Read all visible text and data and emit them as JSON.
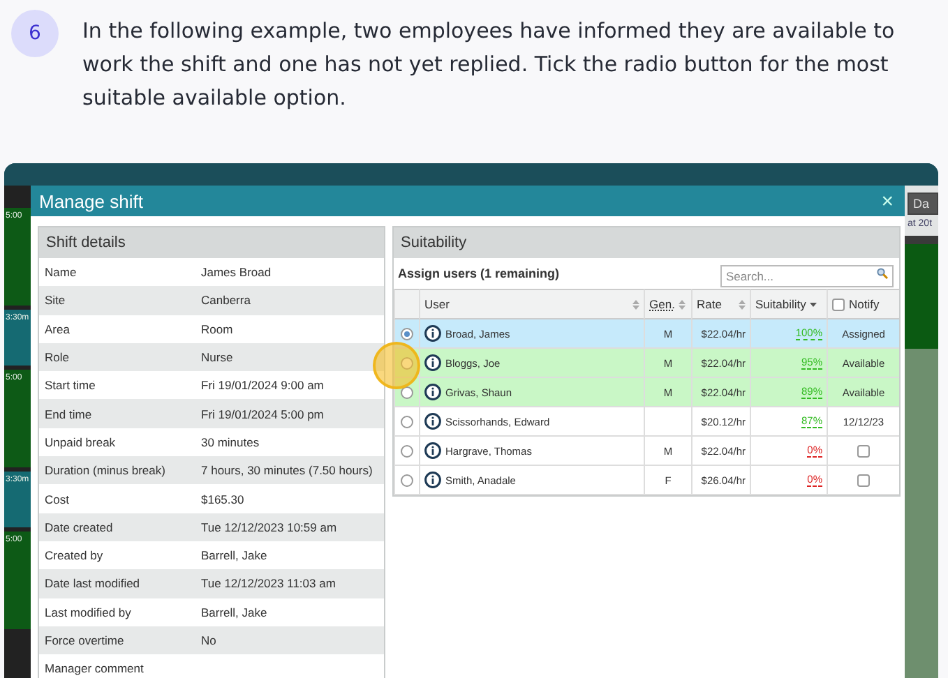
{
  "step": {
    "number": "6",
    "text": "In the following example, two employees have informed they are available to work the shift and one has not yet replied. Tick the radio button for the most suitable available option."
  },
  "background": {
    "left_fragments": [
      "5:00",
      "3:30m",
      "5:00",
      "3:30m",
      "5:00"
    ],
    "right_button": "Da",
    "right_text": "at 20t"
  },
  "dialog": {
    "title": "Manage shift",
    "close": "×",
    "shift_details": {
      "title": "Shift details",
      "rows": [
        {
          "label": "Name",
          "value": "James Broad"
        },
        {
          "label": "Site",
          "value": "Canberra"
        },
        {
          "label": "Area",
          "value": "Room"
        },
        {
          "label": "Role",
          "value": "Nurse"
        },
        {
          "label": "Start time",
          "value": "Fri 19/01/2024 9:00 am"
        },
        {
          "label": "End time",
          "value": "Fri 19/01/2024 5:00 pm"
        },
        {
          "label": "Unpaid break",
          "value": "30 minutes"
        },
        {
          "label": "Duration (minus break)",
          "value": "7 hours, 30 minutes (7.50 hours)"
        },
        {
          "label": "Cost",
          "value": "$165.30"
        },
        {
          "label": "Date created",
          "value": "Tue 12/12/2023 10:59 am"
        },
        {
          "label": "Created by",
          "value": "Barrell, Jake"
        },
        {
          "label": "Date last modified",
          "value": "Tue 12/12/2023 11:03 am"
        },
        {
          "label": "Last modified by",
          "value": "Barrell, Jake"
        },
        {
          "label": "Force overtime",
          "value": "No"
        },
        {
          "label": "Manager comment",
          "value": ""
        }
      ]
    },
    "suitability": {
      "title": "Suitability",
      "assign_label": "Assign users (1 remaining)",
      "search": {
        "placeholder": "Search..."
      },
      "columns": [
        "User",
        "Gen.",
        "Rate",
        "Suitability",
        "Notify"
      ],
      "notify_checked": false,
      "rows": [
        {
          "selected": true,
          "kind": "assigned",
          "user": "Broad, James",
          "gender": "M",
          "rate": "$22.04/hr",
          "suitability": "100%",
          "color": "#33bb22",
          "notify": {
            "kind": "text",
            "text": "Assigned"
          }
        },
        {
          "selected": false,
          "kind": "available",
          "user": "Bloggs, Joe",
          "gender": "M",
          "rate": "$22.04/hr",
          "suitability": "95%",
          "color": "#33bb22",
          "notify": {
            "kind": "text",
            "text": "Available"
          }
        },
        {
          "selected": false,
          "kind": "available",
          "user": "Grivas, Shaun",
          "gender": "M",
          "rate": "$22.04/hr",
          "suitability": "89%",
          "color": "#33bb22",
          "notify": {
            "kind": "text",
            "text": "Available"
          }
        },
        {
          "selected": false,
          "kind": "plain",
          "user": "Scissorhands, Edward",
          "rate": "$20.12/hr",
          "suitability": "87%",
          "color": "#33bb22",
          "notify": {
            "kind": "text",
            "text": "12/12/23"
          }
        },
        {
          "selected": false,
          "kind": "plain",
          "user": "Hargrave, Thomas",
          "gender": "M",
          "rate": "$22.04/hr",
          "suitability": "0%",
          "color": "#dd2222",
          "notify": {
            "kind": "checkbox",
            "checked": false
          }
        },
        {
          "selected": false,
          "kind": "plain",
          "user": "Smith, Anadale",
          "gender": "F",
          "rate": "$26.04/hr",
          "suitability": "0%",
          "color": "#dd2222",
          "notify": {
            "kind": "checkbox",
            "checked": false
          }
        }
      ]
    },
    "highlight_marker": true
  }
}
